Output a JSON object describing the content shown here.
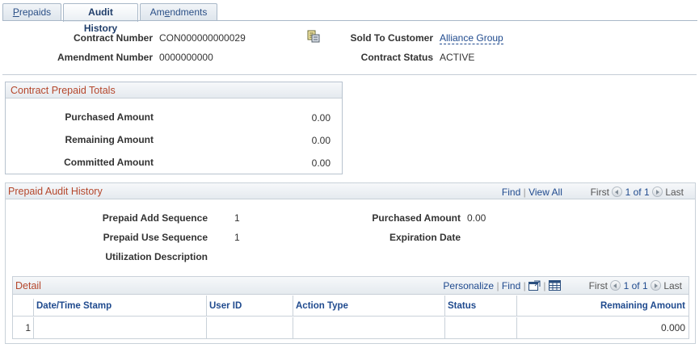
{
  "tabs": [
    {
      "label_pre": "",
      "label_ul": "P",
      "label_post": "repaids"
    },
    {
      "label": "Audit History"
    },
    {
      "label_pre": "Am",
      "label_ul": "e",
      "label_post": "ndments"
    }
  ],
  "header": {
    "contract_number_label": "Contract Number",
    "contract_number": "CON000000000029",
    "amendment_number_label": "Amendment Number",
    "amendment_number": "0000000000",
    "sold_to_label": "Sold To Customer",
    "sold_to": "Alliance Group",
    "status_label": "Contract Status",
    "status": "ACTIVE",
    "icon": "contract-details-icon"
  },
  "totals": {
    "title": "Contract Prepaid Totals",
    "purchased_label": "Purchased Amount",
    "purchased": "0.00",
    "remaining_label": "Remaining Amount",
    "remaining": "0.00",
    "committed_label": "Committed Amount",
    "committed": "0.00"
  },
  "audit": {
    "title": "Prepaid Audit History",
    "find": "Find",
    "view_all": "View All",
    "first": "First",
    "page": "1 of 1",
    "last": "Last",
    "add_seq_label": "Prepaid Add Sequence",
    "add_seq": "1",
    "use_seq_label": "Prepaid Use Sequence",
    "use_seq": "1",
    "util_label": "Utilization Description",
    "util": "",
    "purchased_label": "Purchased Amount",
    "purchased": "0.00",
    "expiration_label": "Expiration Date",
    "expiration": ""
  },
  "detail": {
    "title": "Detail",
    "personalize": "Personalize",
    "find": "Find",
    "first": "First",
    "page": "1 of 1",
    "last": "Last",
    "columns": [
      "Date/Time Stamp",
      "User ID",
      "Action Type",
      "Status",
      "Remaining Amount"
    ],
    "rows": [
      {
        "num": "1",
        "datetime": "",
        "user": "",
        "action": "",
        "status": "",
        "remaining": "0.000"
      }
    ]
  },
  "colors": {
    "accent_title": "#b5472c",
    "link": "#1f4a8e",
    "border": "#b8c3cf"
  }
}
